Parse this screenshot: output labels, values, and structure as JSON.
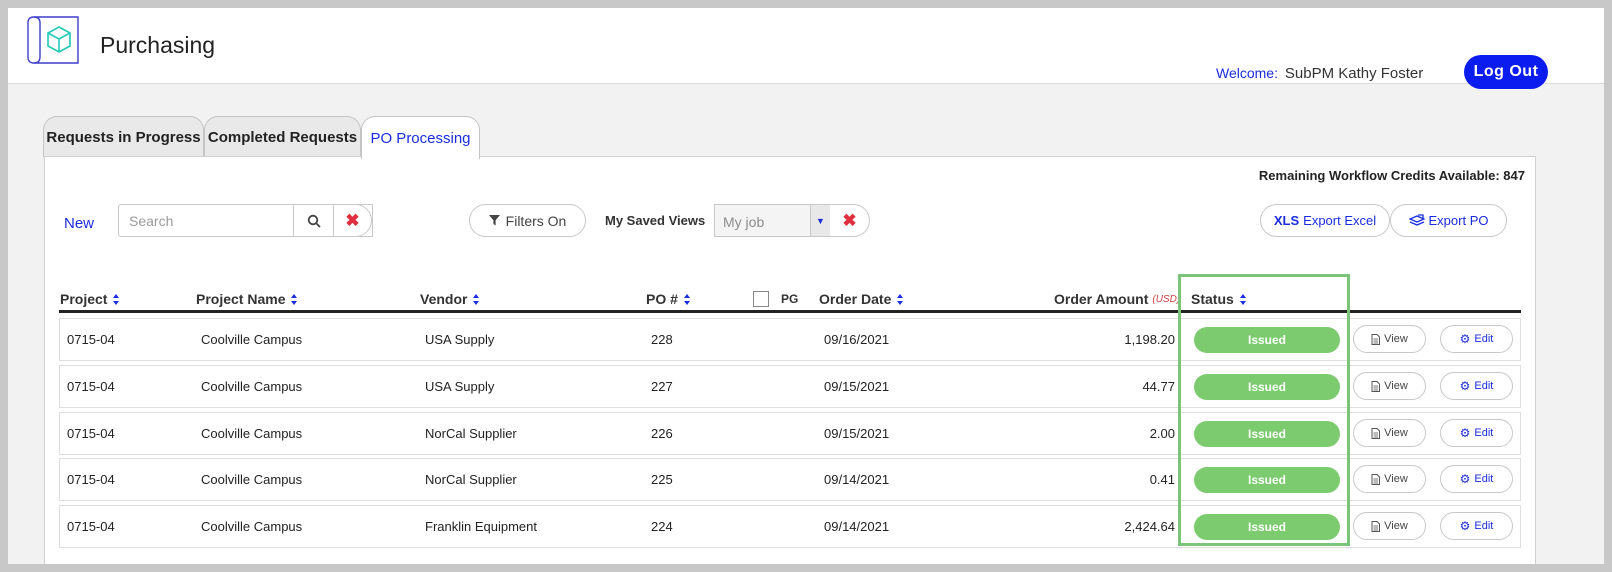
{
  "app": {
    "title": "Purchasing"
  },
  "user": {
    "welcome_label": "Welcome:",
    "name": "SubPM Kathy Foster",
    "logout_label": "Log Out"
  },
  "tabs": [
    {
      "label": "Requests in Progress",
      "active": false
    },
    {
      "label": "Completed Requests",
      "active": false
    },
    {
      "label": "PO Processing",
      "active": true
    }
  ],
  "credits": "Remaining Workflow Credits Available: 847",
  "toolbar": {
    "new_label": "New",
    "search_placeholder": "Search",
    "filters_label": "Filters On",
    "saved_views_label": "My Saved Views",
    "saved_view_value": "My job",
    "export_excel_badge": "XLS",
    "export_excel_label": "Export Excel",
    "export_po_label": "Export PO"
  },
  "columns": {
    "project": "Project",
    "project_name": "Project Name",
    "vendor": "Vendor",
    "po": "PO #",
    "pg": "PG",
    "order_date": "Order Date",
    "order_amount": "Order Amount",
    "currency": "(USD)",
    "status": "Status"
  },
  "rows": [
    {
      "project": "0715-04",
      "project_name": "Coolville Campus",
      "vendor": "USA Supply",
      "po": "228",
      "order_date": "09/16/2021",
      "amount": "1,198.20",
      "status": "Issued",
      "view": "View",
      "edit": "Edit"
    },
    {
      "project": "0715-04",
      "project_name": "Coolville Campus",
      "vendor": "USA Supply",
      "po": "227",
      "order_date": "09/15/2021",
      "amount": "44.77",
      "status": "Issued",
      "view": "View",
      "edit": "Edit"
    },
    {
      "project": "0715-04",
      "project_name": "Coolville Campus",
      "vendor": "NorCal Supplier",
      "po": "226",
      "order_date": "09/15/2021",
      "amount": "2.00",
      "status": "Issued",
      "view": "View",
      "edit": "Edit"
    },
    {
      "project": "0715-04",
      "project_name": "Coolville Campus",
      "vendor": "NorCal Supplier",
      "po": "225",
      "order_date": "09/14/2021",
      "amount": "0.41",
      "status": "Issued",
      "view": "View",
      "edit": "Edit"
    },
    {
      "project": "0715-04",
      "project_name": "Coolville Campus",
      "vendor": "Franklin Equipment",
      "po": "224",
      "order_date": "09/14/2021",
      "amount": "2,424.64",
      "status": "Issued",
      "view": "View",
      "edit": "Edit"
    }
  ],
  "colors": {
    "accent": "#1a2ce0",
    "status_issued": "#7ccb6f",
    "highlight": "#7cc47a",
    "danger": "#e03040"
  },
  "icons": [
    "logo-cube-icon",
    "search-icon",
    "close-icon",
    "filter-icon",
    "chevron-down-icon",
    "excel-icon",
    "export-icon",
    "document-icon",
    "gear-icon",
    "sort-icon"
  ]
}
